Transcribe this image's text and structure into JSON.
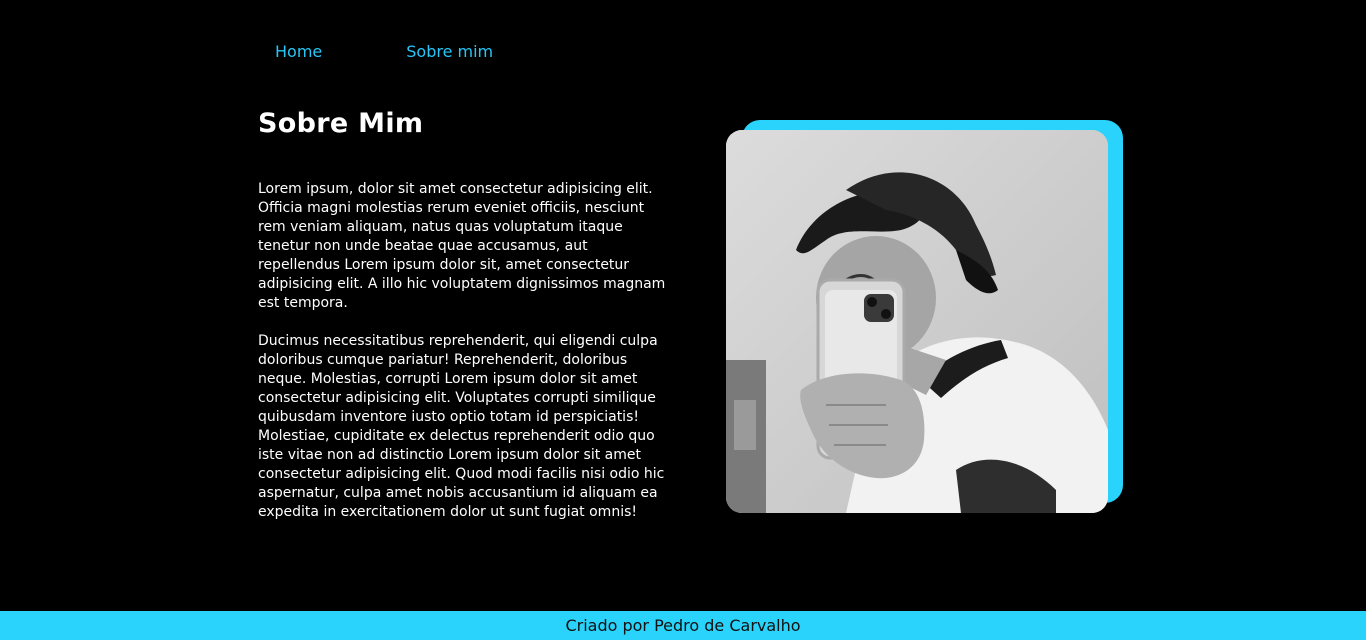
{
  "nav": {
    "items": [
      {
        "label": "Home"
      },
      {
        "label": "Sobre mim"
      }
    ]
  },
  "main": {
    "title": "Sobre Mim",
    "paragraphs": [
      "Lorem ipsum, dolor sit amet consectetur adipisicing elit. Officia magni molestias rerum eveniet officiis, nesciunt rem veniam aliquam, natus quas voluptatum itaque tenetur non unde beatae quae accusamus, aut repellendus Lorem ipsum dolor sit, amet consectetur adipisicing elit. A illo hic voluptatem dignissimos magnam est tempora.",
      "Ducimus necessitatibus reprehenderit, qui eligendi culpa doloribus cumque pariatur! Reprehenderit, doloribus neque. Molestias, corrupti Lorem ipsum dolor sit amet consectetur adipisicing elit. Voluptates corrupti similique quibusdam inventore iusto optio totam id perspiciatis! Molestiae, cupiditate ex delectus reprehenderit odio quo iste vitae non ad distinctio Lorem ipsum dolor sit amet consectetur adipisicing elit. Quod modi facilis nisi odio hic aspernatur, culpa amet nobis accusantium id aliquam ea expedita in exercitationem dolor ut sunt fugiat omnis!"
    ]
  },
  "footer": {
    "text": "Criado por Pedro de Carvalho"
  },
  "colors": {
    "accent": "#29d3fb",
    "link": "#29c5f6",
    "background": "#000000"
  }
}
